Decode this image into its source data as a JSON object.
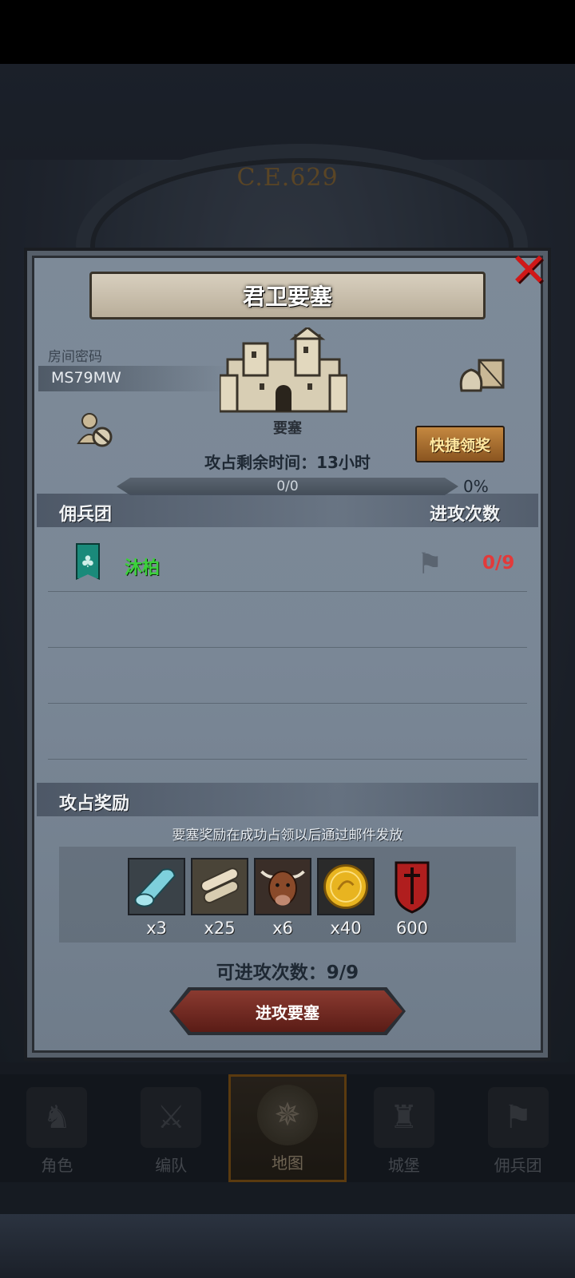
{
  "header": {
    "year": "C.E.629"
  },
  "dialog": {
    "title": "君卫要塞",
    "room_label": "房间密码",
    "room_code": "MS79MW",
    "fortress_label": "要塞",
    "quick_claim": "快捷领奖",
    "time_label": "攻占剩余时间：",
    "time_value": "13小时",
    "progress_text": "0/0",
    "progress_percent": "0%",
    "progress_fraction": 0,
    "mercenary_header": "佣兵团",
    "attack_header": "进攻次数",
    "mercenary_rows": [
      {
        "name": "沐柏",
        "attacks": "0/9",
        "banner_color": "#1a8a7a"
      }
    ],
    "reward_header": "攻占奖励",
    "reward_note": "要塞奖励在成功占领以后通过邮件发放",
    "rewards": [
      {
        "icon": "cloth-roll-icon",
        "qty": "x3"
      },
      {
        "icon": "scroll-icon",
        "qty": "x25"
      },
      {
        "icon": "cattle-icon",
        "qty": "x6"
      },
      {
        "icon": "gold-coin-icon",
        "qty": "x40"
      },
      {
        "icon": "sword-emblem-icon",
        "qty": "600"
      }
    ],
    "available_label": "可进攻次数：",
    "available_value": "9/9",
    "attack_button": "进攻要塞"
  },
  "nav": [
    {
      "label": "角色",
      "icon": "knight-icon"
    },
    {
      "label": "编队",
      "icon": "formation-icon"
    },
    {
      "label": "地图",
      "icon": "map-compass-icon",
      "active": true
    },
    {
      "label": "城堡",
      "icon": "castle-icon"
    },
    {
      "label": "佣兵团",
      "icon": "mercenary-icon"
    }
  ],
  "colors": {
    "accent_green": "#3cd03c",
    "accent_red": "#e23a3a",
    "close_red": "#d01818"
  }
}
